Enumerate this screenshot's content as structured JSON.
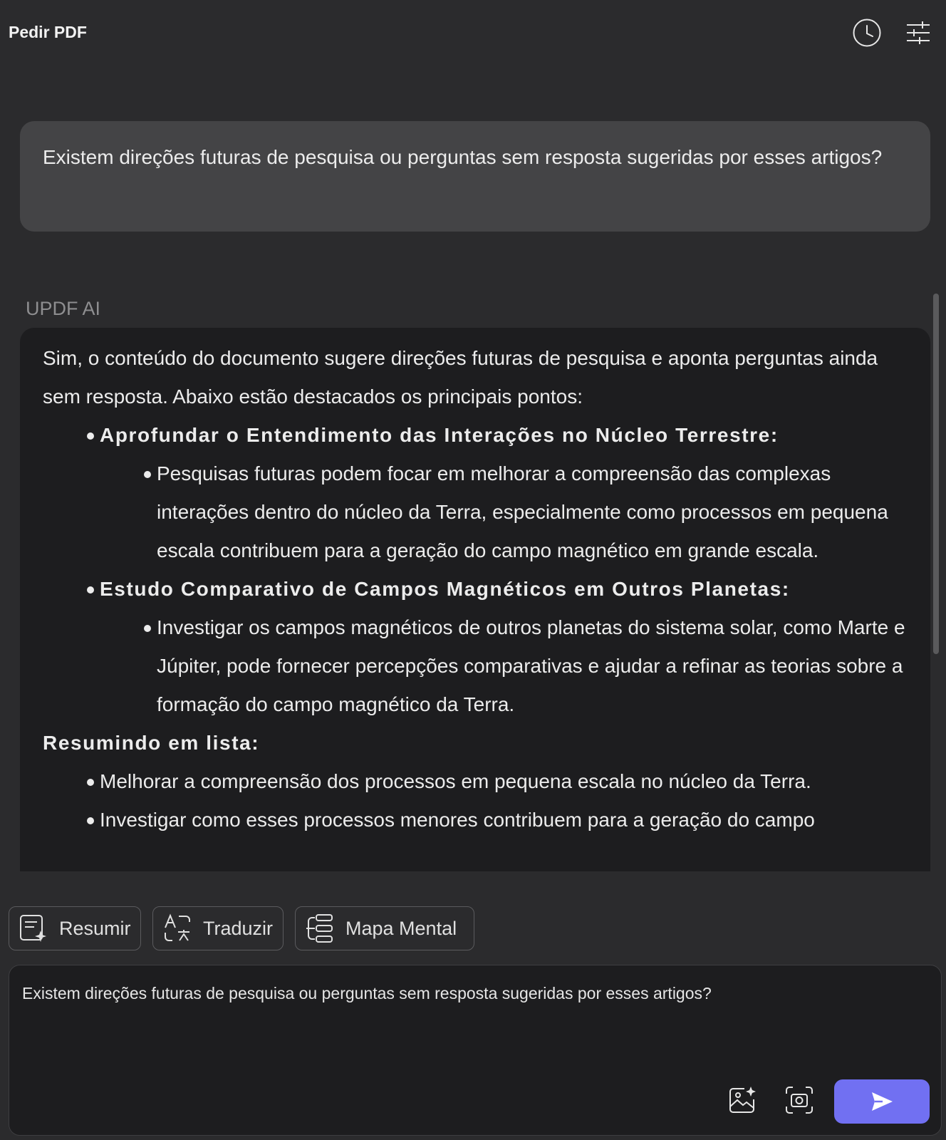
{
  "header": {
    "title": "Pedir PDF",
    "icons": [
      "history-icon",
      "settings-sliders-icon"
    ]
  },
  "user_message": {
    "text": "Existem direções futuras de pesquisa ou perguntas sem resposta sugeridas por esses artigos?"
  },
  "ai": {
    "label": "UPDF AI",
    "intro": "Sim, o conteúdo do documento sugere direções futuras de pesquisa e aponta perguntas ainda sem resposta. Abaixo estão destacados os principais pontos:",
    "points": [
      {
        "heading": "Aprofundar o Entendimento das Interações no Núcleo Terrestre:",
        "detail": "Pesquisas futuras podem focar em melhorar a compreensão das complexas interações dentro do núcleo da Terra, especialmente como processos em pequena escala contribuem para a geração do campo magnético em grande escala."
      },
      {
        "heading": "Estudo Comparativo de Campos Magnéticos em Outros Planetas:",
        "detail": "Investigar os campos magnéticos de outros planetas do sistema solar, como Marte e Júpiter, pode fornecer percepções comparativas e ajudar a refinar as teorias sobre a formação do campo magnético da Terra."
      }
    ],
    "summary_heading": "Resumindo em lista:",
    "summary_items": [
      "Melhorar a compreensão dos processos em pequena escala no núcleo da Terra.",
      "Investigar como esses processos menores contribuem para a geração do campo"
    ]
  },
  "quick_actions": {
    "summarize": "Resumir",
    "translate": "Traduzir",
    "mind_map": "Mapa Mental"
  },
  "composer": {
    "value": "Existem direções futuras de pesquisa ou perguntas sem resposta sugeridas por esses artigos?",
    "icons": [
      "image-ai-icon",
      "camera-icon",
      "send-icon"
    ]
  },
  "colors": {
    "background": "#2b2b2d",
    "user_bubble": "#444446",
    "ai_bubble": "#1d1d1f",
    "accent": "#7170f2",
    "muted_label": "#8e8e90"
  }
}
